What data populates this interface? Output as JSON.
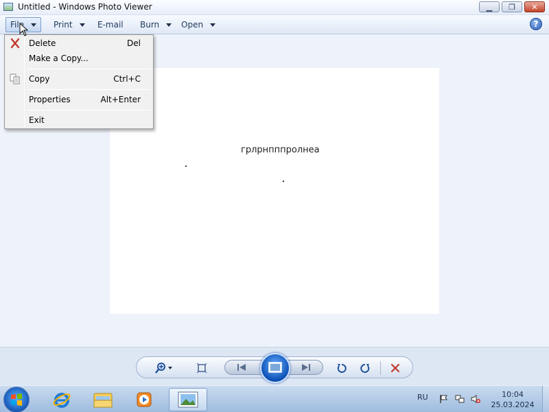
{
  "window": {
    "title": "Untitled - Windows Photo Viewer",
    "buttons": {
      "minimize": "▁",
      "maximize": "❐",
      "close": "✕"
    }
  },
  "commandbar": {
    "file": "File",
    "print": "Print",
    "email": "E-mail",
    "burn": "Burn",
    "open": "Open",
    "help": "?"
  },
  "file_menu": {
    "items": [
      {
        "label": "Delete",
        "shortcut": "Del",
        "icon": "delete-x-icon"
      },
      {
        "label": "Make a Copy...",
        "shortcut": ""
      },
      {
        "label": "Copy",
        "shortcut": "Ctrl+C",
        "icon": "copy-icon"
      },
      {
        "label": "Properties",
        "shortcut": "Alt+Enter"
      },
      {
        "label": "Exit",
        "shortcut": ""
      }
    ]
  },
  "photo": {
    "text": "грлрнпппролнеа"
  },
  "toolbar_icons": [
    "zoom-icon",
    "actual-size-icon",
    "previous-icon",
    "slideshow-icon",
    "next-icon",
    "rotate-ccw-icon",
    "rotate-cw-icon",
    "delete-icon"
  ],
  "taskbar": {
    "apps": [
      "internet-explorer-icon",
      "explorer-folder-icon",
      "media-player-icon",
      "photo-viewer-icon"
    ],
    "language": "RU",
    "time": "10:04",
    "date": "25.03.2024"
  }
}
